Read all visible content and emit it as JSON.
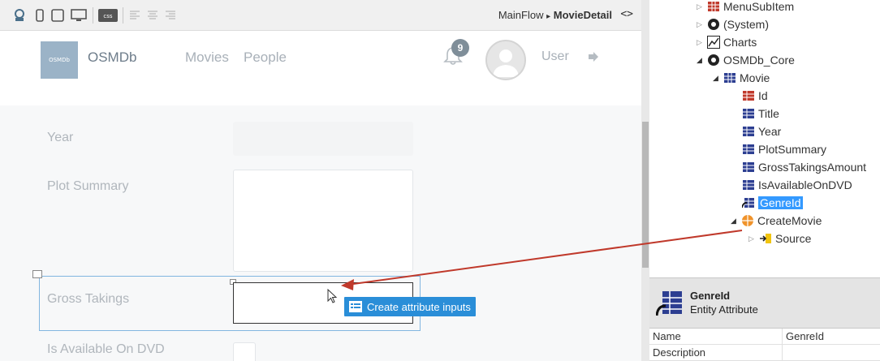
{
  "toolbar": {
    "breadcrumb_flow": "MainFlow",
    "breadcrumb_sep": "▸",
    "breadcrumb_current": "MovieDetail",
    "code_toggle": "<>",
    "css_label": "css"
  },
  "app": {
    "logo_text": "OSMDb",
    "title": "OSMDb",
    "nav": [
      "Movies",
      "People"
    ],
    "notification_count": "9",
    "user_label": "User"
  },
  "form": {
    "labels": {
      "year": "Year",
      "plot_summary": "Plot Summary",
      "gross_takings": "Gross Takings",
      "is_available": "Is Available On DVD"
    },
    "drop_tooltip": "Create attribute inputs"
  },
  "tree": {
    "items": [
      {
        "label": "MenuSubItem",
        "icon": "entity-grid-icon"
      },
      {
        "label": "(System)",
        "icon": "module-circle-icon"
      },
      {
        "label": "Charts",
        "icon": "chart-line-icon"
      },
      {
        "label": "OSMDb_Core",
        "icon": "module-circle-icon"
      },
      {
        "label": "Movie",
        "icon": "entity-grid-icon"
      },
      {
        "label": "Id",
        "icon": "attribute-key-icon"
      },
      {
        "label": "Title",
        "icon": "attribute-icon"
      },
      {
        "label": "Year",
        "icon": "attribute-icon"
      },
      {
        "label": "PlotSummary",
        "icon": "attribute-icon"
      },
      {
        "label": "GrossTakingsAmount",
        "icon": "attribute-icon"
      },
      {
        "label": "IsAvailableOnDVD",
        "icon": "attribute-icon"
      },
      {
        "label": "GenreId",
        "icon": "attribute-reference-icon"
      },
      {
        "label": "CreateMovie",
        "icon": "action-icon"
      },
      {
        "label": "Source",
        "icon": "source-icon"
      }
    ]
  },
  "properties": {
    "name": "GenreId",
    "type": "Entity Attribute",
    "rows": [
      {
        "key": "Name",
        "value": "GenreId"
      },
      {
        "key": "Description",
        "value": ""
      }
    ]
  },
  "colors": {
    "accent": "#2a8ed8",
    "selection": "#3399ff",
    "drag_arrow": "#c0392b"
  }
}
